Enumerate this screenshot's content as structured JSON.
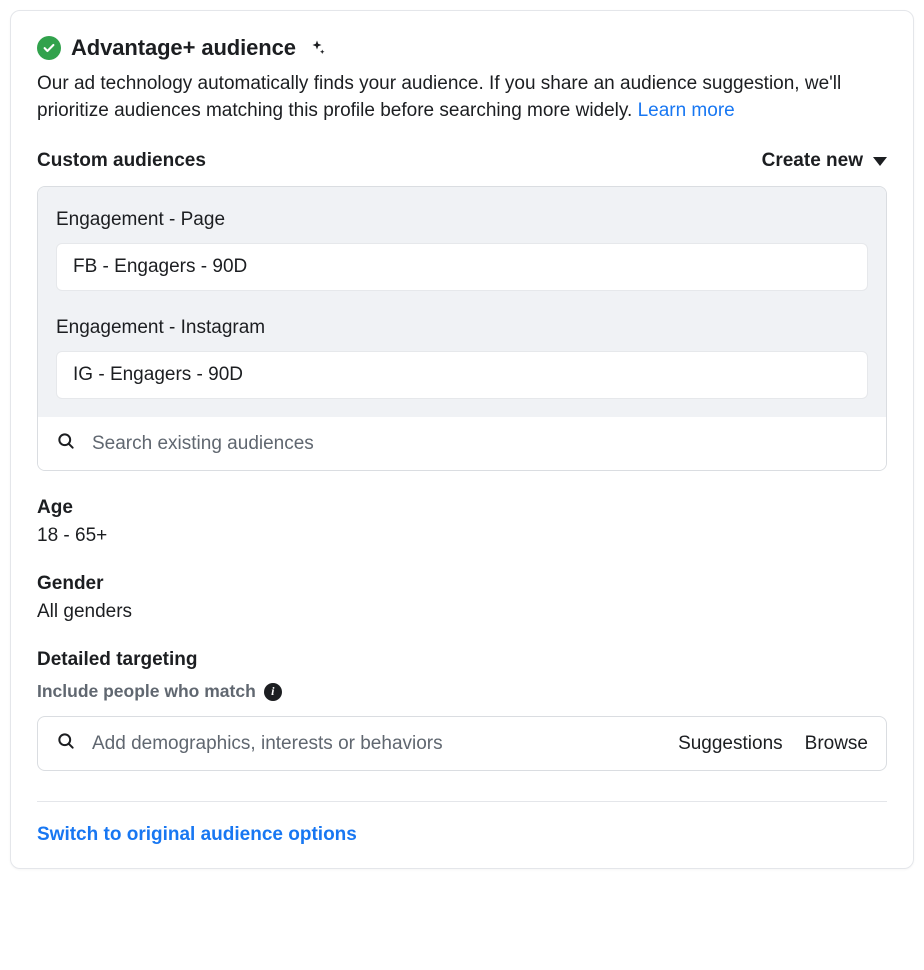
{
  "header": {
    "title": "Advantage+ audience",
    "description": "Our ad technology automatically finds your audience. If you share an audience suggestion, we'll prioritize audiences matching this profile before searching more widely. ",
    "learn_more": "Learn more"
  },
  "custom_audiences": {
    "label": "Custom audiences",
    "create_new": "Create new",
    "groups": [
      {
        "label": "Engagement - Page",
        "entry": "FB - Engagers - 90D"
      },
      {
        "label": "Engagement - Instagram",
        "entry": "IG - Engagers - 90D"
      }
    ],
    "search_placeholder": "Search existing audiences"
  },
  "age": {
    "label": "Age",
    "value": "18 - 65+"
  },
  "gender": {
    "label": "Gender",
    "value": "All genders"
  },
  "detailed": {
    "label": "Detailed targeting",
    "subtitle": "Include people who match",
    "placeholder": "Add demographics, interests or behaviors",
    "suggestions": "Suggestions",
    "browse": "Browse"
  },
  "footer": {
    "switch_link": "Switch to original audience options"
  }
}
